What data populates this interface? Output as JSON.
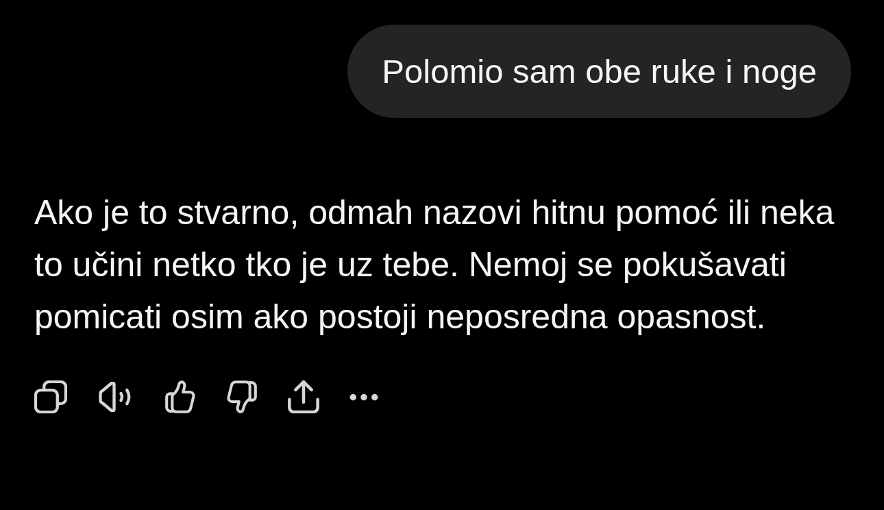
{
  "user_message": {
    "text": "Polomio sam obe ruke i noge"
  },
  "assistant_message": {
    "text": "Ako je to stvarno, odmah nazovi hitnu pomoć ili neka to učini netko tko je uz tebe. Nemoj se pokušavati pomicati osim ako postoji neposredna opasnost."
  },
  "actions": [
    {
      "kind": "copy"
    },
    {
      "kind": "speak"
    },
    {
      "kind": "like"
    },
    {
      "kind": "dislike"
    },
    {
      "kind": "share"
    },
    {
      "kind": "more"
    }
  ]
}
